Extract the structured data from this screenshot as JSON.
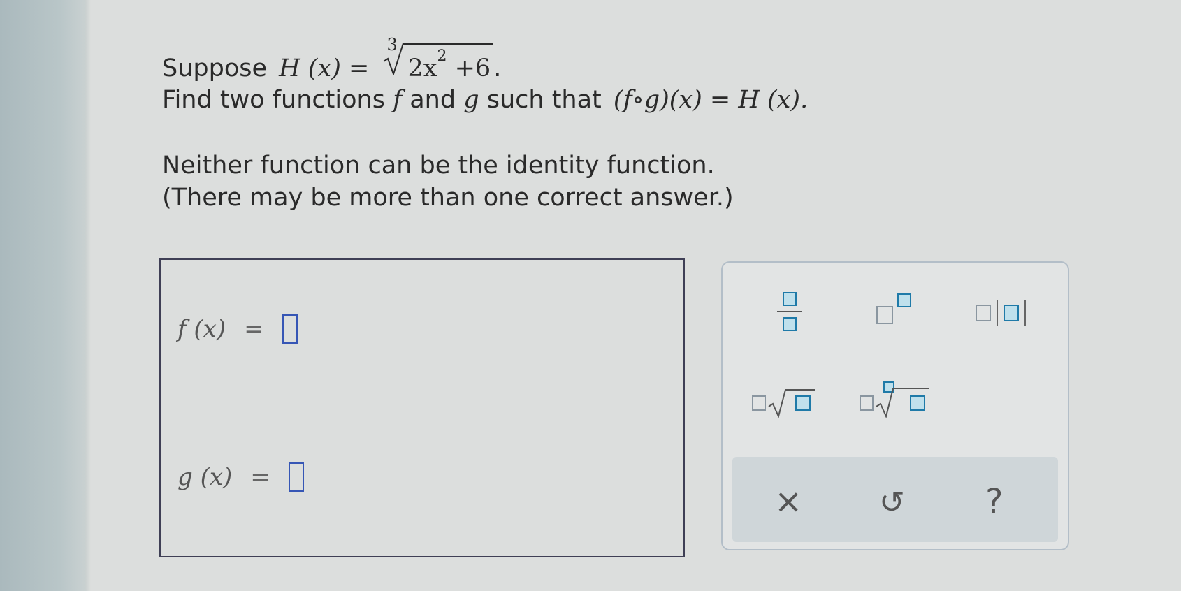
{
  "question": {
    "line1_prefix": "Suppose",
    "H_lhs": "H (x) =",
    "root_index": "3",
    "radicand_base": "2x",
    "radicand_exp": "2",
    "radicand_rest": "+6",
    "line1_end": ".",
    "line2_prefix": "Find two functions",
    "line2_f": "f",
    "line2_and": "and",
    "line2_g": "g",
    "line2_such": "such that",
    "line2_math": "(f∘g)(x) = H (x).",
    "line3": "Neither function can be the identity function.",
    "line4": "(There may be more than one correct answer.)"
  },
  "answers": {
    "f_label": "f (x)",
    "g_label": "g (x)",
    "equals": "="
  },
  "palette": {
    "fraction": "fraction-button",
    "superscript": "superscript-button",
    "absolute_value": "absolute-value-button",
    "mixed_sqrt": "sqrt-button",
    "nth_root": "nth-root-button",
    "clear_symbol": "×",
    "undo_symbol": "↺",
    "help_symbol": "?"
  }
}
